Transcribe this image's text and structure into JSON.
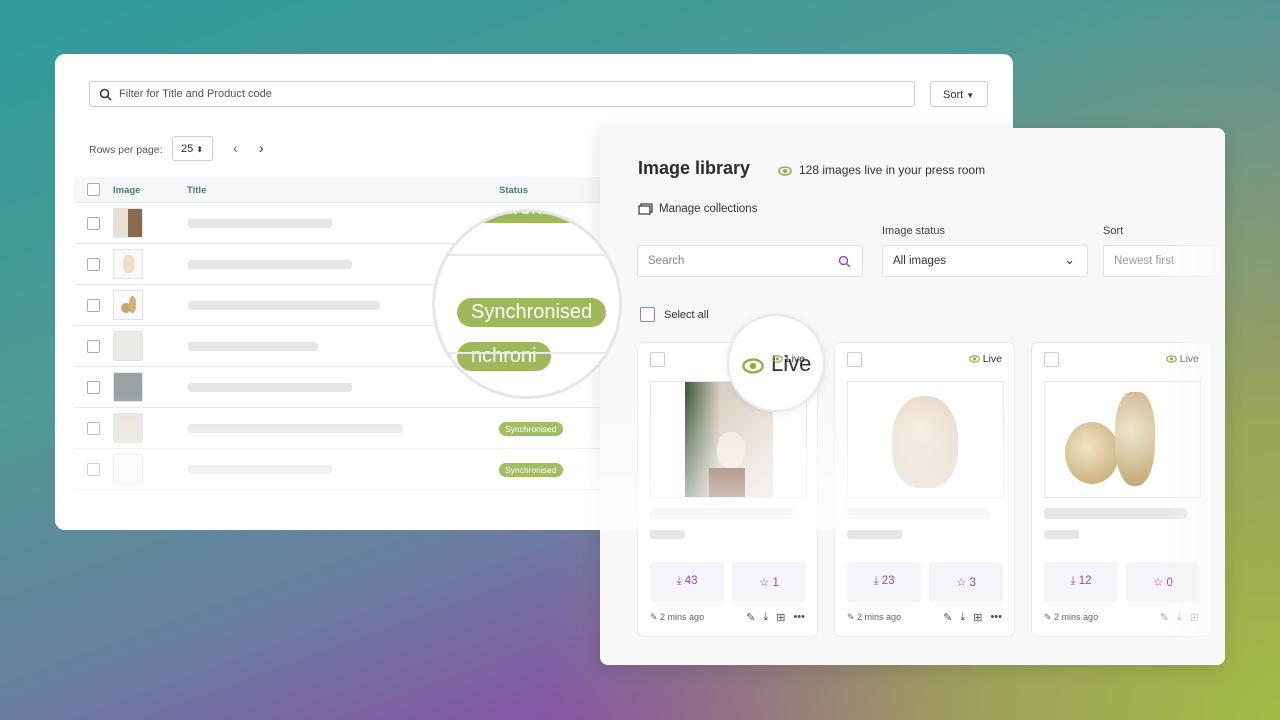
{
  "table_panel": {
    "filter_placeholder": "Filter for Title and Product code",
    "sort_label": "Sort",
    "rows_per_page_label": "Rows per page:",
    "rows_per_page_value": "25",
    "columns": [
      "Image",
      "Title",
      "Status"
    ],
    "rows": [
      {
        "status": ""
      },
      {
        "status": ""
      },
      {
        "status": ""
      },
      {
        "status": ""
      },
      {
        "status": ""
      },
      {
        "status": "Synchronised"
      },
      {
        "status": "Synchronised"
      }
    ],
    "magnified_status": "Synchronised",
    "magnified_partial_top": "ynchronise",
    "magnified_partial_bottom": "nchroni"
  },
  "library": {
    "title": "Image library",
    "live_summary": "128 images live in your press room",
    "manage_collections": "Manage collections",
    "image_status_label": "Image status",
    "sort_label": "Sort",
    "search_placeholder": "Search",
    "image_status_value": "All images",
    "sort_value": "Newest first",
    "select_all": "Select all",
    "magnified_live": "Live",
    "cards": [
      {
        "live": "Live",
        "downloads": "43",
        "favorites": "1",
        "updated": "2 mins ago"
      },
      {
        "live": "Live",
        "downloads": "23",
        "favorites": "3",
        "updated": "2 mins ago"
      },
      {
        "live": "Live",
        "downloads": "12",
        "favorites": "0",
        "updated": "2 mins ago"
      }
    ]
  },
  "colors": {
    "accent_purple": "#9b4ba6",
    "live_green": "#8fae45",
    "badge_green": "#a3bd62"
  }
}
